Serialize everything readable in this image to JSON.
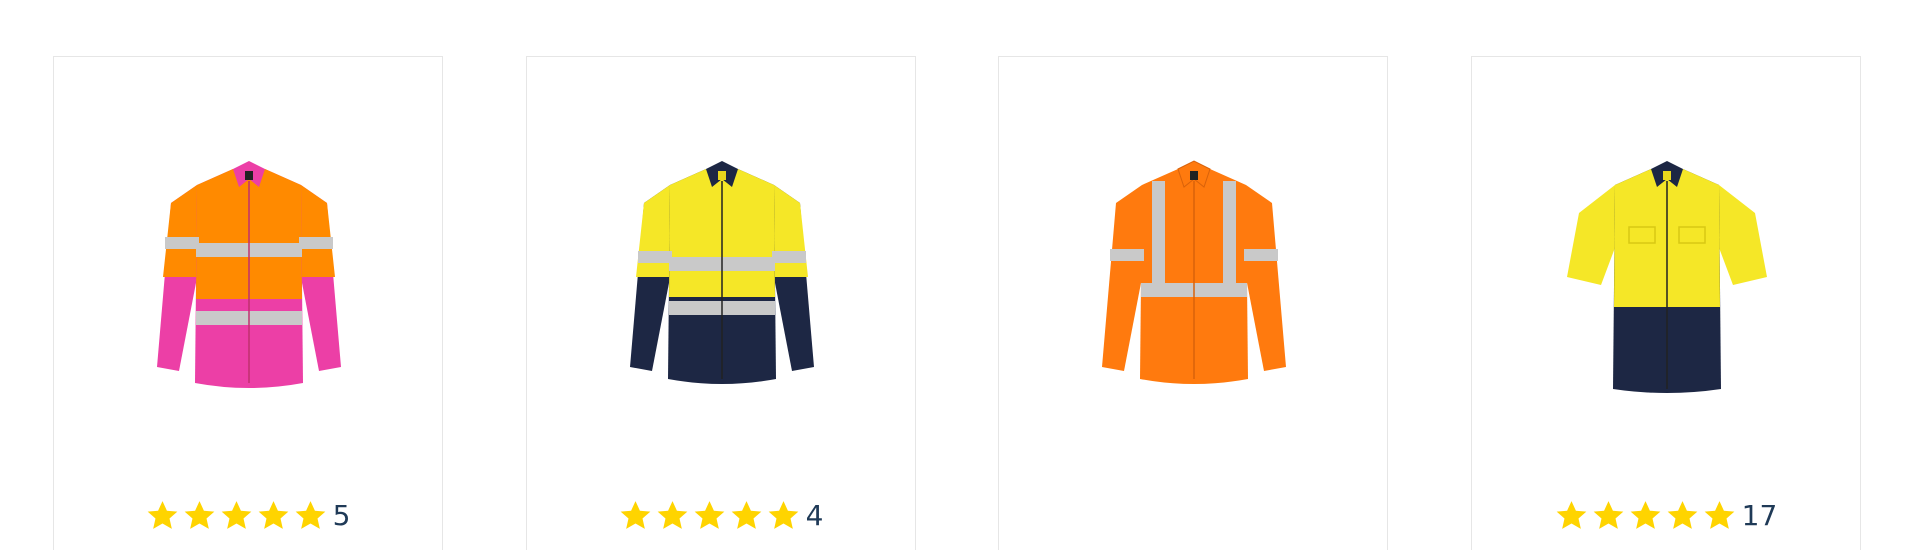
{
  "products": [
    {
      "name_icon": "hi-vis-shirt-orange-pink-icon",
      "colors": {
        "top": "#ff8a00",
        "bottom": "#ec3fa6",
        "tape": "#c9c9c9",
        "collar": "#ec3fa6"
      },
      "rating_value": 5,
      "review_count": "5"
    },
    {
      "name_icon": "hi-vis-shirt-yellow-navy-icon",
      "colors": {
        "top": "#f5e727",
        "bottom": "#1d2744",
        "tape": "#c9c9c9",
        "collar": "#1d2744"
      },
      "rating_value": 5,
      "review_count": "4"
    },
    {
      "name_icon": "hi-vis-shirt-orange-x-back-icon",
      "colors": {
        "top": "#ff7a0e",
        "bottom": "#ff7a0e",
        "tape": "#c9c9c9",
        "collar": "#ff7a0e"
      },
      "rating_value": null,
      "review_count": ""
    },
    {
      "name_icon": "hi-vis-shirt-yellow-navy-short-sleeve-icon",
      "colors": {
        "top": "#f5e727",
        "bottom": "#1d2744",
        "tape": "",
        "collar": "#1d2744"
      },
      "rating_value": 5,
      "review_count": "17"
    }
  ],
  "star_color": "#ffd400"
}
